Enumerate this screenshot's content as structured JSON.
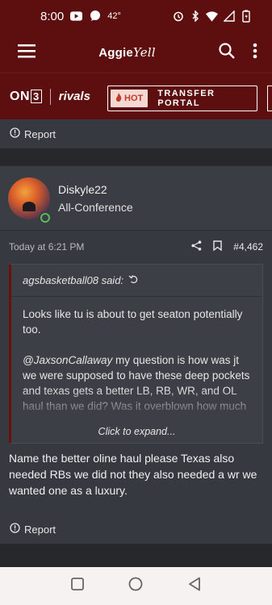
{
  "status_bar": {
    "time": "8:00",
    "temperature": "42°",
    "icons": [
      "youtube-icon",
      "chat-icon",
      "alarm-icon",
      "bluetooth-icon",
      "wifi-icon",
      "signal-icon",
      "battery-icon"
    ]
  },
  "app_bar": {
    "brand_main": "Aggie",
    "brand_script": "Yell",
    "icons": [
      "menu-icon",
      "search-icon",
      "more-vert-icon"
    ]
  },
  "partners": {
    "on3_prefix": "ON",
    "on3_box": "3",
    "rivals": "rivals",
    "hot_badge": "HOT",
    "hot_link": "TRANSFER PORTAL"
  },
  "top_report": {
    "label": "Report"
  },
  "author": {
    "username": "Diskyle22",
    "rank": "All-Conference"
  },
  "post": {
    "timestamp": "Today at 6:21 PM",
    "post_number": "#4,462",
    "quote": {
      "author_said": "agsbasketball08 said:",
      "line1": "Looks like tu is about to get seaton potentially too.",
      "mention": "@JaxsonCallaway",
      "line2": " my question is how was jt we were supposed to have these deep pockets and texas gets a better LB, RB, WR, and OL haul than we did? Was it overblown how much",
      "expand_label": "Click to expand..."
    },
    "body": "Name the better oline haul please Texas also needed RBs we did not they also needed a wr we wanted one as a luxury."
  },
  "bottom_report": {
    "label": "Report"
  },
  "colors": {
    "maroon": "#5d0f0f",
    "background": "#2f3136",
    "card": "#36393f",
    "online_green": "#5cb85c"
  }
}
